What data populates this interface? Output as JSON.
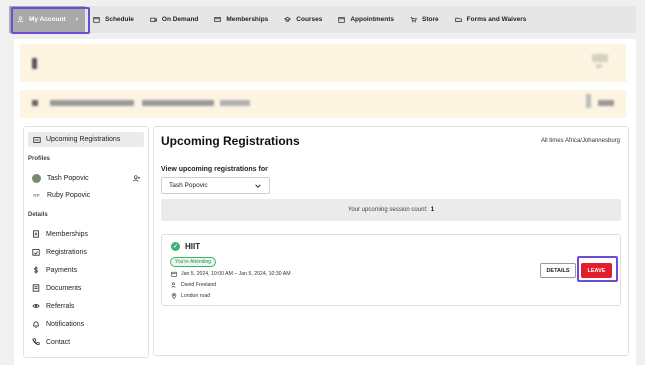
{
  "nav": {
    "account": "My Account",
    "account_chevron": "›",
    "items": [
      {
        "label": "Schedule",
        "icon": "calendar-icon"
      },
      {
        "label": "On Demand",
        "icon": "video-icon"
      },
      {
        "label": "Memberships",
        "icon": "card-icon"
      },
      {
        "label": "Courses",
        "icon": "cap-icon"
      },
      {
        "label": "Appointments",
        "icon": "calendar-icon"
      },
      {
        "label": "Store",
        "icon": "cart-icon"
      },
      {
        "label": "Forms and Waivers",
        "icon": "folder-icon"
      }
    ]
  },
  "sidebar": {
    "active": "Upcoming Registrations",
    "profiles_heading": "Profiles",
    "profiles": [
      {
        "name": "Tash Popovic"
      },
      {
        "name": "Ruby Popovic",
        "initials": "RP"
      }
    ],
    "details_heading": "Details",
    "details": [
      {
        "label": "Memberships",
        "icon": "membership-icon"
      },
      {
        "label": "Registrations",
        "icon": "registrations-icon"
      },
      {
        "label": "Payments",
        "icon": "dollar-icon"
      },
      {
        "label": "Documents",
        "icon": "document-icon"
      },
      {
        "label": "Referrals",
        "icon": "referral-icon"
      },
      {
        "label": "Notifications",
        "icon": "bell-icon"
      },
      {
        "label": "Contact",
        "icon": "phone-icon"
      }
    ]
  },
  "main": {
    "title": "Upcoming Registrations",
    "timezone": "All times Africa/Johannesburg",
    "view_label": "View upcoming registrations for",
    "selected_profile": "Tash Popovic",
    "count_label": "Your upcoming session count:",
    "count_value": "1",
    "session": {
      "name": "HIIT",
      "status": "You're Attending",
      "datetime": "Jan 5, 2024, 10:00 AM – Jan 5, 2024, 10:30 AM",
      "instructor": "David Freeland",
      "location": "London road",
      "details_button": "DETAILS",
      "leave_button": "LEAVE"
    }
  },
  "colors": {
    "accent_highlight": "#6c4bd6",
    "leave": "#e01e2d",
    "attending": "#3cb371"
  }
}
